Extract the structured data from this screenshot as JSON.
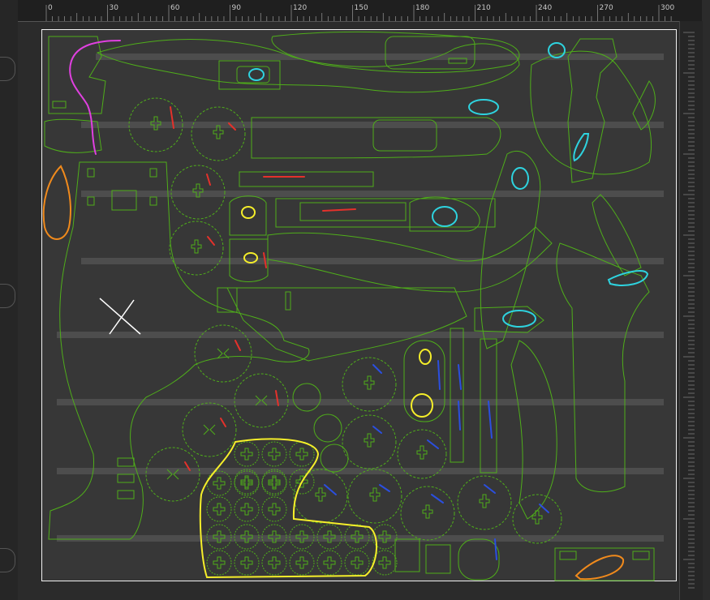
{
  "app": {
    "colors": {
      "background": "#2b2b2b",
      "bed": "#373737",
      "bed_border": "#f2f2f2",
      "cut_lines": "#4fae1a",
      "raster_bars": "#4d4d4d",
      "ruler": "#1f1f1f"
    }
  },
  "ruler": {
    "labels": [
      "0",
      "30",
      "60",
      "90",
      "120",
      "150",
      "180",
      "210",
      "240",
      "270",
      "300"
    ]
  },
  "annotations": {
    "cursor_marker": "cross-marker-icon",
    "stroke_colors": {
      "magenta": "#e040e0",
      "orange": "#f08a1c",
      "cyan": "#2ed3df",
      "yellow": "#f5ee2a",
      "red": "#e4312b",
      "blue": "#2b4fe0"
    }
  }
}
